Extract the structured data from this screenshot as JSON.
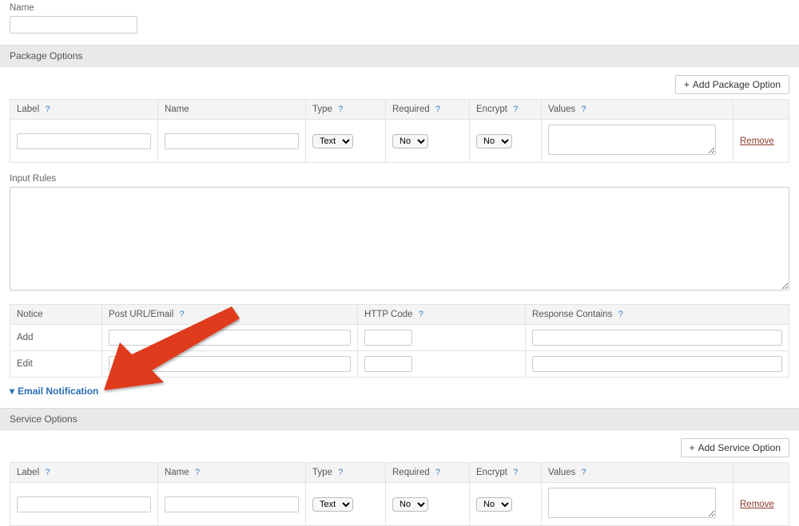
{
  "name_field": {
    "label": "Name",
    "value": ""
  },
  "help": "?",
  "package_options": {
    "header": "Package Options",
    "add_button": "Add Package Option",
    "columns": {
      "label": "Label",
      "name": "Name",
      "type": "Type",
      "required": "Required",
      "encrypt": "Encrypt",
      "values": "Values"
    },
    "row": {
      "type_selected": "Text",
      "required_selected": "No",
      "encrypt_selected": "No",
      "remove": "Remove"
    }
  },
  "input_rules": {
    "label": "Input Rules",
    "value": ""
  },
  "notice_table": {
    "columns": {
      "notice": "Notice",
      "post": "Post URL/Email",
      "http": "HTTP Code",
      "response": "Response Contains"
    },
    "rows": {
      "add": "Add",
      "edit": "Edit"
    }
  },
  "email_notification": "Email Notification",
  "service_options": {
    "header": "Service Options",
    "add_button": "Add Service Option",
    "columns": {
      "label": "Label",
      "name": "Name",
      "type": "Type",
      "required": "Required",
      "encrypt": "Encrypt",
      "values": "Values"
    },
    "row": {
      "type_selected": "Text",
      "required_selected": "No",
      "encrypt_selected": "No",
      "remove": "Remove"
    }
  }
}
